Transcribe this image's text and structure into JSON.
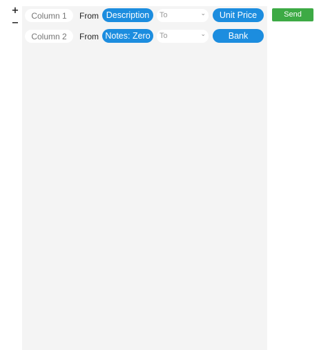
{
  "controls": {
    "add_symbol": "+",
    "remove_symbol": "−",
    "send_label": "Send"
  },
  "rows": [
    {
      "column_placeholder": "Column 1",
      "from_label": "From",
      "from_value": "Description",
      "to_placeholder": "To",
      "to_value": "Unit Price"
    },
    {
      "column_placeholder": "Column 2",
      "from_label": "From",
      "from_value": "Notes: Zero",
      "to_placeholder": "To",
      "to_value": "Bank"
    }
  ],
  "colors": {
    "accent_blue": "#1c8ddf",
    "send_green": "#3daa45",
    "panel_bg": "#f4f4f4"
  },
  "icons": {
    "add": "plus-icon",
    "remove": "minus-icon",
    "dropdown": "chevron-down-icon"
  }
}
